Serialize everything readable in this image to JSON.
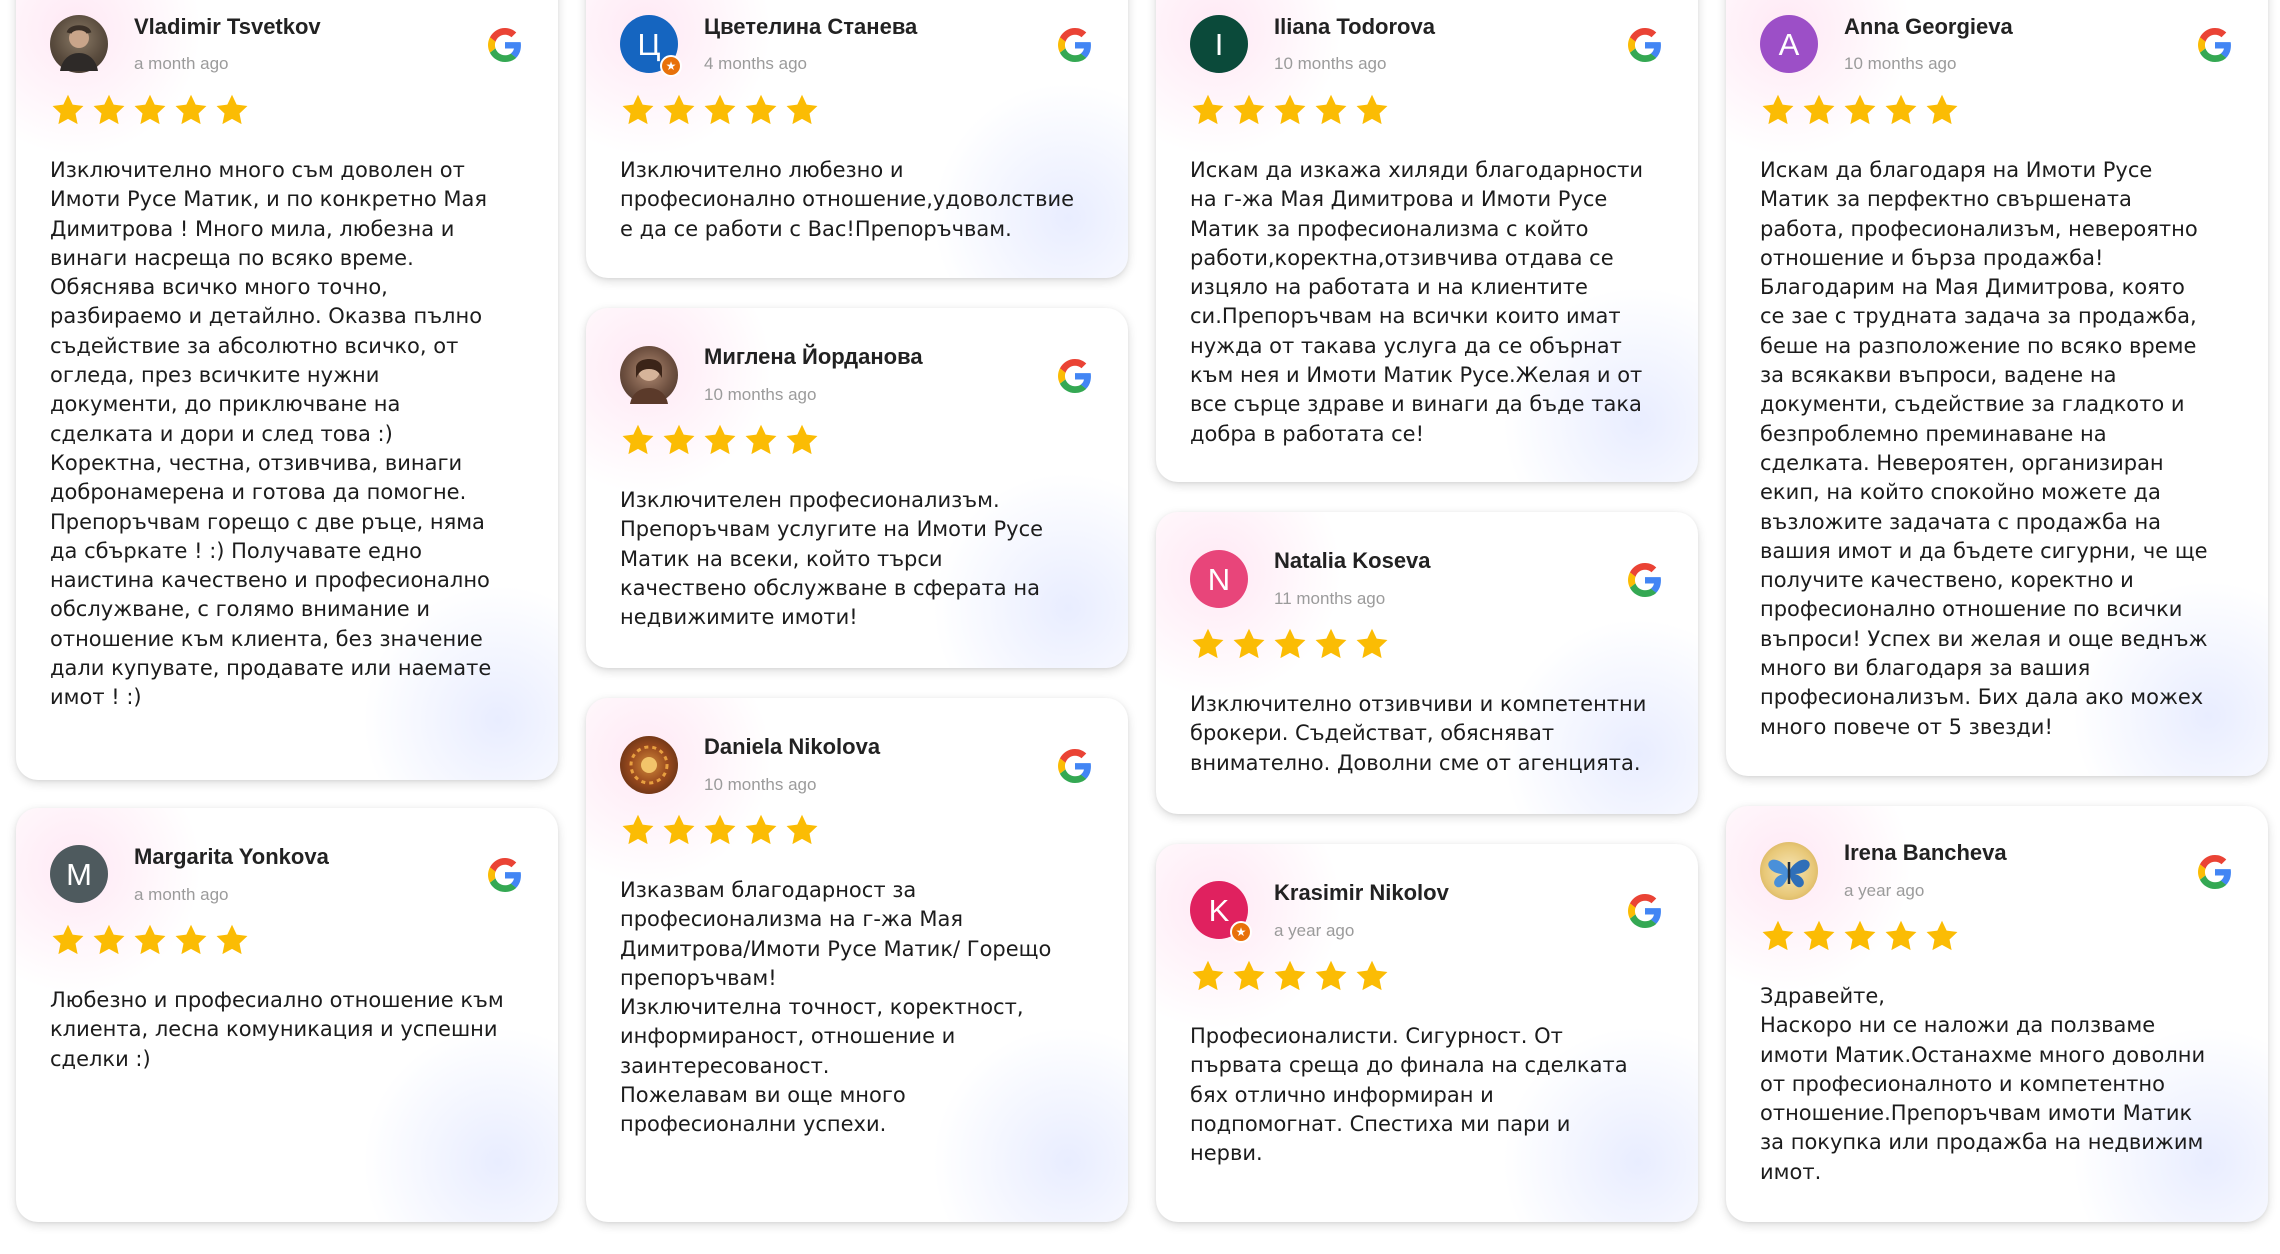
{
  "colors": {
    "star": "#fbbc04",
    "avatar_tsvetelina": "#1565c0",
    "avatar_iliana": "#0b4a3a",
    "avatar_anna": "#9c4fc7",
    "avatar_margarita": "#4e5a5e",
    "avatar_natalia": "#e8457a",
    "avatar_krasimir": "#e0215f"
  },
  "reviews": [
    {
      "name": "Vladimir Tsvetkov",
      "date": "a month ago",
      "rating": 5,
      "avatar": "photo",
      "text": "Изключително много съм доволен от\nИмоти Русе Матик, и по конкретно Мая\nДимитрова ! Много мила, любезна и\nвинаги насреща по всяко време.\nОбяснява всичко много точно,\nразбираемо и детайлно. Оказва пълно\nсъдействие за абсолютно всичко, от\nогледа, през всичките нужни\nдокументи, до приключване на\nсделката и дори и след това :)\nКоректна, честна, отзивчива, винаги\nдобронамерена и готова да помогне.\nПрепоръчвам горещо с две ръце, няма\nда сбъркате ! :) Получавате едно\nнаистина качествено и професионално\nобслужване, с голямо внимание и\nотношение към клиента, без значение\nдали купувате, продавате или наемате\nимот ! :)"
    },
    {
      "name": "Margarita Yonkova",
      "date": "a month ago",
      "rating": 5,
      "avatar_letter": "M",
      "text": "Любезно и професиално отношение към\nклиента, лесна комуникация и успешни\nсделки :)"
    },
    {
      "name": "Цветелина Станева",
      "date": "4 months ago",
      "rating": 5,
      "avatar_letter": "Ц",
      "text": "Изключително любезно и\nпрофесионално отношение,удоволствие\nе да се работи с Вас!Препоръчвам."
    },
    {
      "name": "Миглена Йорданова",
      "date": "10 months ago",
      "rating": 5,
      "avatar": "photo",
      "text": "Изключителен професионализъм.\nПрепоръчвам услугите на  Имоти Русе\nМатик на всеки, който търси\nкачествено обслужване в сферата на\nнедвижимите имоти!"
    },
    {
      "name": "Daniela Nikolova",
      "date": "10 months ago",
      "rating": 5,
      "avatar": "photo",
      "text": "Изказвам благодарност за\nпрофесионализма на  г-жа Мая\nДимитрова/Имоти Русе Матик/ Горещо\nпрепоръчвам!\nИзключителна точност, коректност,\nинформираност, отношение и\nзаинтересованост.\nПожелавам ви още много\nпрофесионални успехи."
    },
    {
      "name": "Iliana Todorova",
      "date": "10 months ago",
      "rating": 5,
      "avatar_letter": "I",
      "text": "Искам да изкажа хиляди благодарности\nна г-жа Мая Димитрова и Имоти Русе\nМатик за професионализма с който\nработи,коректна,отзивчива отдава се\nизцяло на работата и на клиентите\nси.Препоръчвам на всички които имат\nнужда от такава услуга да се обърнат\nкъм нея и Имоти Матик Русе.Желая и от\nвсе сърце здраве и винаги да бъде така\nдобра в работата се!"
    },
    {
      "name": "Natalia Koseva",
      "date": "11 months ago",
      "rating": 5,
      "avatar_letter": "N",
      "text": "Изключително отзивчиви и компетентни\nброкери. Съдействат, обясняват\nвнимателно. Доволни сме от агенцията."
    },
    {
      "name": "Krasimir Nikolov",
      "date": "a year ago",
      "rating": 5,
      "avatar_letter": "K",
      "text": "Професионалисти.  Сигурност. От\nпървата среща до финала на сделката\nбях отлично  информиран и\nподпомогнат.  Спестиха ми пари и\nнерви."
    },
    {
      "name": "Anna Georgieva",
      "date": "10 months ago",
      "rating": 5,
      "avatar_letter": "A",
      "text": "Искам да благодаря на Имоти Русе\nМатик за перфектно свършената\nработа, професионализъм, невероятно\nотношение и бърза продажба!\nБлагодарим на Мая Димитрова, която\nсе зае с трудната задача за продажба,\nбеше на разположение по всяко време\nза всякакви въпроси, вадене на\nдокументи, съдействие за гладкото и\nбезпроблемно преминаване на\nсделката. Невероятен, организиран\nекип, на който спокойно можете да\nвъзложите задачата с продажба на\nвашия имот и да бъдете сигурни, че ще\nполучите качествено, коректно и\nпрофесионално отношение по всички\nвъпроси! Успех ви желая и още веднъж\nмного ви благодаря за вашия\nпрофесионализъм. Бих дала ако можех\nмного повече от 5 звезди!"
    },
    {
      "name": "Irena Bancheva",
      "date": "a year ago",
      "rating": 5,
      "avatar": "photo",
      "text": "Здравейте,\nНаскоро ни се наложи да ползваме\nимоти Матик.Останахме много доволни\nот професионалното и компетентно\nотношение.Препоръчвам имоти Матик\nза покупка или продажба на недвижим\nимот."
    }
  ]
}
